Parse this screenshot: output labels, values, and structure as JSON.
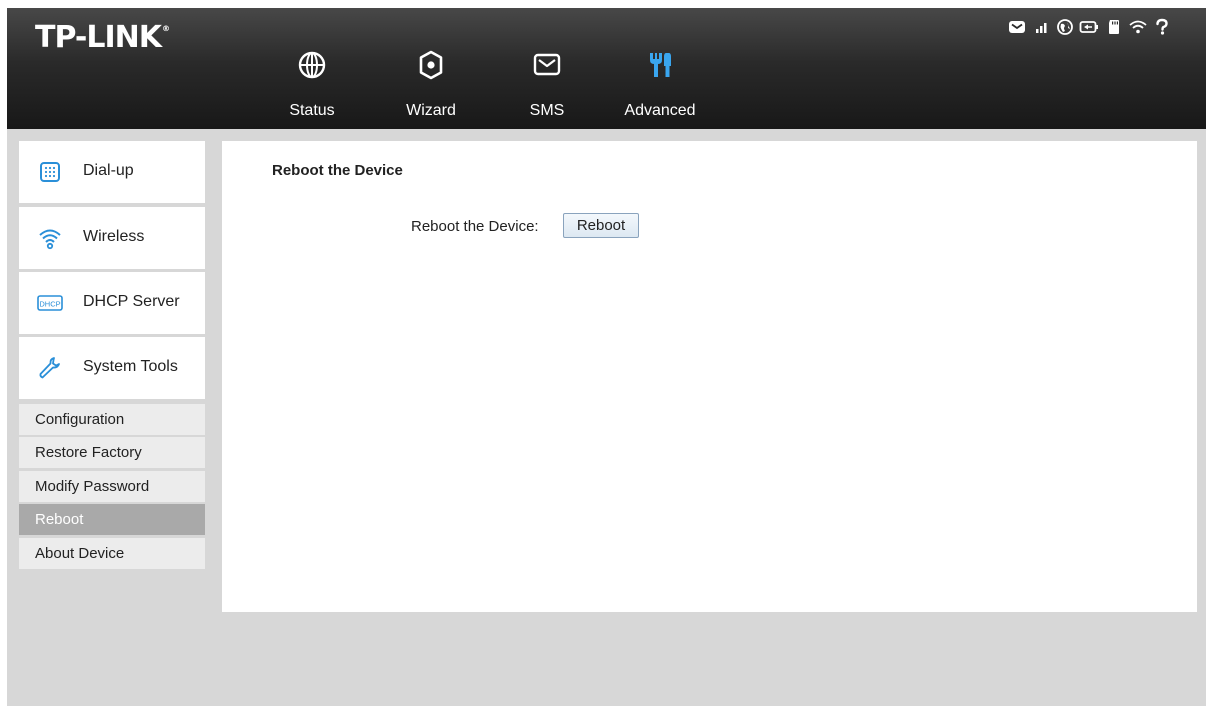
{
  "brand": {
    "logo_text": "TP-LINK"
  },
  "nav": [
    {
      "label": "Status",
      "icon": "globe-icon"
    },
    {
      "label": "Wizard",
      "icon": "gear-icon"
    },
    {
      "label": "SMS",
      "icon": "envelope-icon"
    },
    {
      "label": "Advanced",
      "icon": "tools-icon",
      "active": true
    }
  ],
  "status_icons": [
    "message-icon",
    "signal-icon",
    "internet-icon",
    "battery-icon",
    "sd-card-icon",
    "wifi-icon",
    "help-icon"
  ],
  "sidebar": {
    "main_items": [
      {
        "label": "Dial-up",
        "icon": "keypad-icon"
      },
      {
        "label": "Wireless",
        "icon": "wifi-icon"
      },
      {
        "label": "DHCP Server",
        "icon": "dhcp-icon",
        "icon_text": "DHCP"
      },
      {
        "label": "System Tools",
        "icon": "wrench-icon"
      }
    ],
    "sub_items": [
      {
        "label": "Configuration"
      },
      {
        "label": "Restore Factory"
      },
      {
        "label": "Modify Password"
      },
      {
        "label": "Reboot",
        "active": true
      },
      {
        "label": "About Device"
      }
    ]
  },
  "main": {
    "section_title": "Reboot the Device",
    "field_label": "Reboot the Device:",
    "button_label": "Reboot"
  },
  "colors": {
    "header_dark": "#1c1c1c",
    "accent_blue": "#2a8fd8",
    "active_sub_bg": "#a9a9a9",
    "page_bg": "#d7d7d7"
  }
}
